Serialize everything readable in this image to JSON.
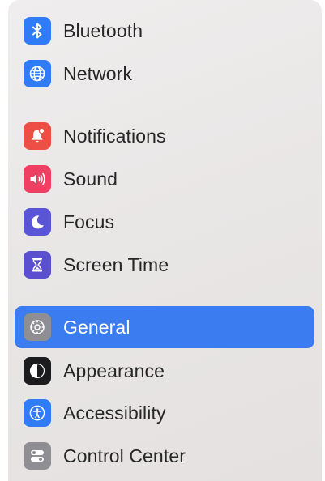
{
  "sidebar": {
    "items": [
      {
        "label": "Bluetooth",
        "icon": "bluetooth-icon",
        "color": "#2f7cf6"
      },
      {
        "label": "Network",
        "icon": "globe-icon",
        "color": "#2f7cf6"
      },
      {
        "label": "Notifications",
        "icon": "bell-badge-icon",
        "color": "#ee4f45"
      },
      {
        "label": "Sound",
        "icon": "speaker-icon",
        "color": "#ef3f63"
      },
      {
        "label": "Focus",
        "icon": "moon-icon",
        "color": "#5a55d6"
      },
      {
        "label": "Screen Time",
        "icon": "hourglass-icon",
        "color": "#5a50cf"
      },
      {
        "label": "General",
        "icon": "gear-icon",
        "color": "#8e8e93",
        "selected": true
      },
      {
        "label": "Appearance",
        "icon": "appearance-icon",
        "color": "#1c1c1e"
      },
      {
        "label": "Accessibility",
        "icon": "accessibility-icon",
        "color": "#2f7cf6"
      },
      {
        "label": "Control Center",
        "icon": "toggles-icon",
        "color": "#8e8e93"
      }
    ]
  }
}
